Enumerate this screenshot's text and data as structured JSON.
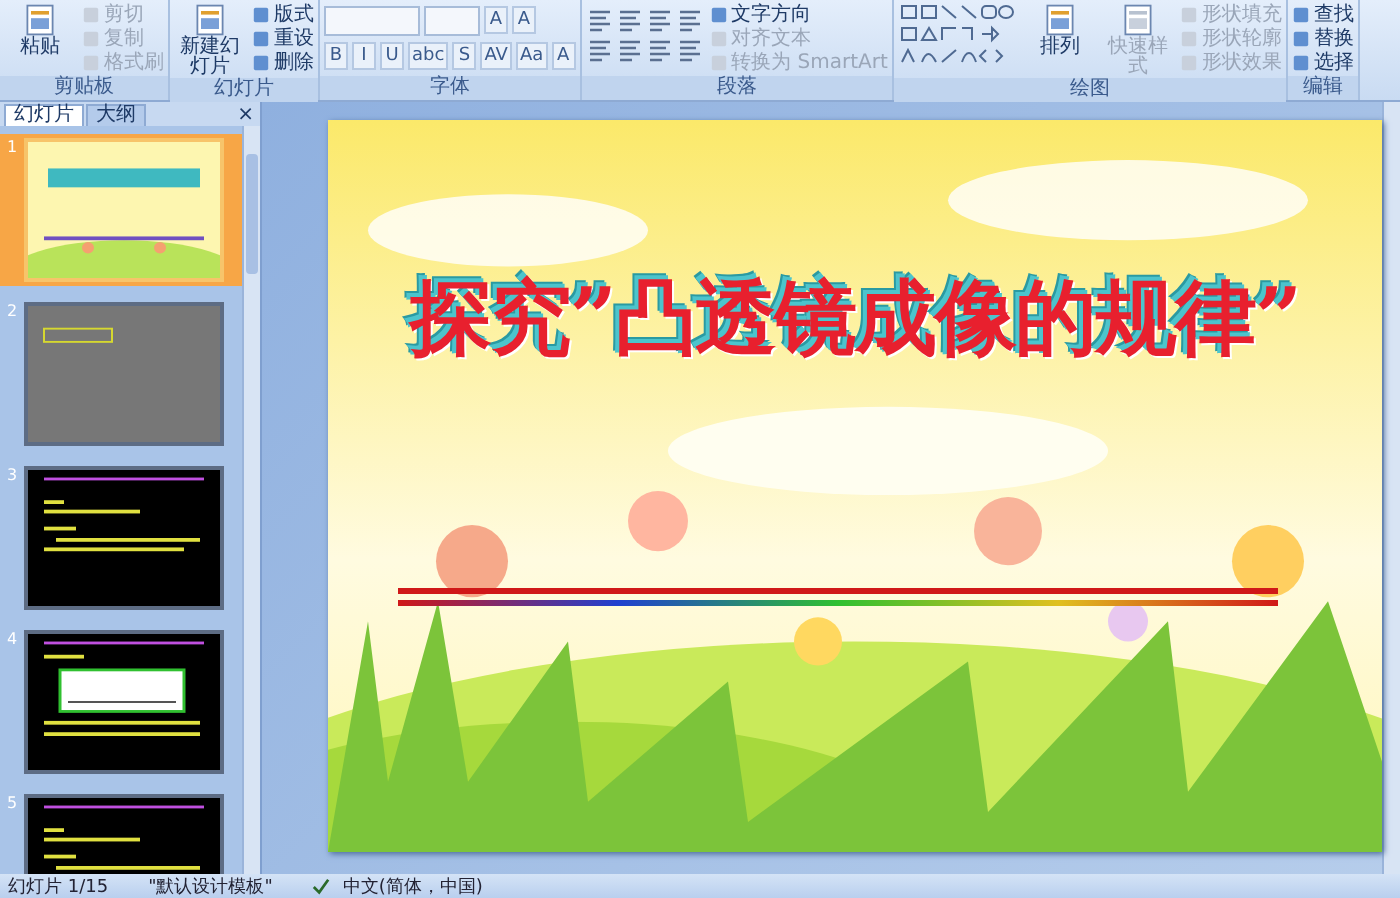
{
  "ribbon": {
    "groups": [
      {
        "label": "剪贴板",
        "columns": [
          {
            "kind": "big",
            "label": "粘贴",
            "disabled": false
          },
          {
            "kind": "stack",
            "items": [
              {
                "label": "剪切",
                "disabled": true
              },
              {
                "label": "复制",
                "disabled": true
              },
              {
                "label": "格式刷",
                "disabled": true
              }
            ]
          }
        ]
      },
      {
        "label": "幻灯片",
        "columns": [
          {
            "kind": "big",
            "label": "新建幻灯片",
            "disabled": false
          },
          {
            "kind": "stack",
            "items": [
              {
                "label": "版式",
                "disabled": false
              },
              {
                "label": "重设",
                "disabled": false
              },
              {
                "label": "删除",
                "disabled": false
              }
            ]
          }
        ]
      },
      {
        "label": "字体",
        "columns": [
          {
            "kind": "font",
            "top": [
              "A",
              "A"
            ],
            "bottom": [
              "B",
              "I",
              "U",
              "abc",
              "S",
              "AV",
              "Aa",
              "A"
            ]
          }
        ]
      },
      {
        "label": "段落",
        "columns": [
          {
            "kind": "para-icons"
          },
          {
            "kind": "stack",
            "items": [
              {
                "label": "文字方向",
                "disabled": false
              },
              {
                "label": "对齐文本",
                "disabled": true
              },
              {
                "label": "转换为 SmartArt",
                "disabled": true
              }
            ]
          }
        ]
      },
      {
        "label": "绘图",
        "columns": [
          {
            "kind": "shapes"
          },
          {
            "kind": "big",
            "label": "排列",
            "disabled": false
          },
          {
            "kind": "big",
            "label": "快速样式",
            "disabled": true
          },
          {
            "kind": "stack",
            "items": [
              {
                "label": "形状填充",
                "disabled": true
              },
              {
                "label": "形状轮廓",
                "disabled": true
              },
              {
                "label": "形状效果",
                "disabled": true
              }
            ]
          }
        ]
      },
      {
        "label": "编辑",
        "columns": [
          {
            "kind": "stack",
            "items": [
              {
                "label": "查找",
                "disabled": false
              },
              {
                "label": "替换",
                "disabled": false
              },
              {
                "label": "选择",
                "disabled": false
              }
            ]
          }
        ]
      }
    ]
  },
  "pane": {
    "tabs": [
      {
        "label": "幻灯片",
        "selected": true
      },
      {
        "label": "大纲",
        "selected": false
      }
    ],
    "close": "×",
    "slides": [
      {
        "number": "1",
        "selected": true,
        "kind": "title"
      },
      {
        "number": "2",
        "selected": false,
        "kind": "gray"
      },
      {
        "number": "3",
        "selected": false,
        "kind": "text"
      },
      {
        "number": "4",
        "selected": false,
        "kind": "diagram"
      },
      {
        "number": "5",
        "selected": false,
        "kind": "text"
      }
    ]
  },
  "slide": {
    "title": "探究”凸透镜成像的规律”"
  },
  "status_bar": {
    "position": "幻灯片 1/15",
    "theme": "\"默认设计模板\"",
    "language": "中文(简体，中国)"
  }
}
